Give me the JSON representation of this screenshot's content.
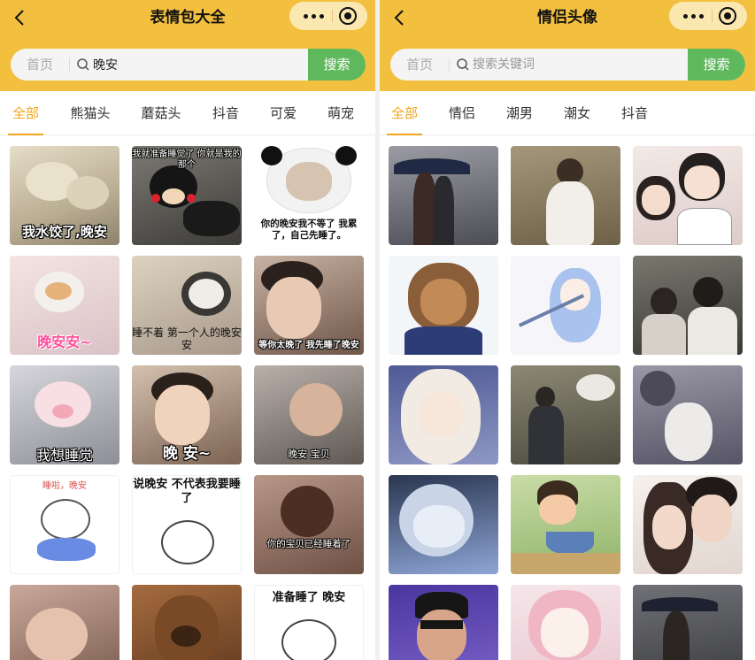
{
  "left": {
    "title": "表情包大全",
    "search": {
      "home_label": "首页",
      "value": "晚安",
      "button": "搜索"
    },
    "tabs": [
      "全部",
      "熊猫头",
      "蘑菇头",
      "抖音",
      "可爱",
      "萌宠"
    ],
    "active_tab": "全部",
    "tiles": [
      {
        "caption": "我水饺了,晚安",
        "bg": "#c9bfa7"
      },
      {
        "caption": "我就准备睡觉了 你就是我的那个",
        "bg": "#5d5a55"
      },
      {
        "caption": "你的晚安我不等了 我累了，自己先睡了。",
        "bg": "#ffffff"
      },
      {
        "caption": "晚安安~",
        "bg": "#efd7d7"
      },
      {
        "caption": "睡不着 第一个人的晚安安",
        "bg": "#cfc2b0"
      },
      {
        "caption": "等你太晚了 我先睡了晚安",
        "bg": "#9a7f6d"
      },
      {
        "caption": "我想睡觉",
        "bg": "#bfbfc7"
      },
      {
        "caption": "晚    安~",
        "bg": "#a88f7c"
      },
      {
        "caption": "晚安 宝贝",
        "bg": "#8e8680"
      },
      {
        "caption": "睡啦，晚安",
        "bg": "#ffffff"
      },
      {
        "caption": "说晚安 不代表我要睡了",
        "bg": "#ffffff"
      },
      {
        "caption": "你的宝贝已经睡着了",
        "bg": "#8f7468"
      },
      {
        "caption": "",
        "bg": "#9c7669"
      },
      {
        "caption": "",
        "bg": "#8a5b37"
      },
      {
        "caption": "准备睡了 晚安",
        "bg": "#ffffff"
      }
    ]
  },
  "right": {
    "title": "情侣头像",
    "search": {
      "home_label": "首页",
      "placeholder": "搜索关键词",
      "button": "搜索"
    },
    "tabs": [
      "全部",
      "情侣",
      "潮男",
      "潮女",
      "抖音"
    ],
    "active_tab": "全部",
    "tiles": [
      {
        "bg": "#6a6b72"
      },
      {
        "bg": "#8c7f63"
      },
      {
        "bg": "#e8dcd8"
      },
      {
        "bg": "#eef3f5"
      },
      {
        "bg": "#f4f4f8"
      },
      {
        "bg": "#55544f"
      },
      {
        "bg": "#7b86b4"
      },
      {
        "bg": "#6d6a5c"
      },
      {
        "bg": "#7c7b8c"
      },
      {
        "bg": "#5f6e92"
      },
      {
        "bg": "#b9cf8f"
      },
      {
        "bg": "#efe6e1"
      },
      {
        "bg": "#5c46a8"
      },
      {
        "bg": "#f1d7de"
      },
      {
        "bg": "#595a5e"
      }
    ]
  },
  "colors": {
    "header": "#f2c03e",
    "accent": "#f2a51c",
    "search_button": "#5fb85c"
  },
  "icons": {
    "back": "chevron-left-icon",
    "more": "more-dots-icon",
    "close": "target-circle-icon",
    "search": "search-icon"
  }
}
